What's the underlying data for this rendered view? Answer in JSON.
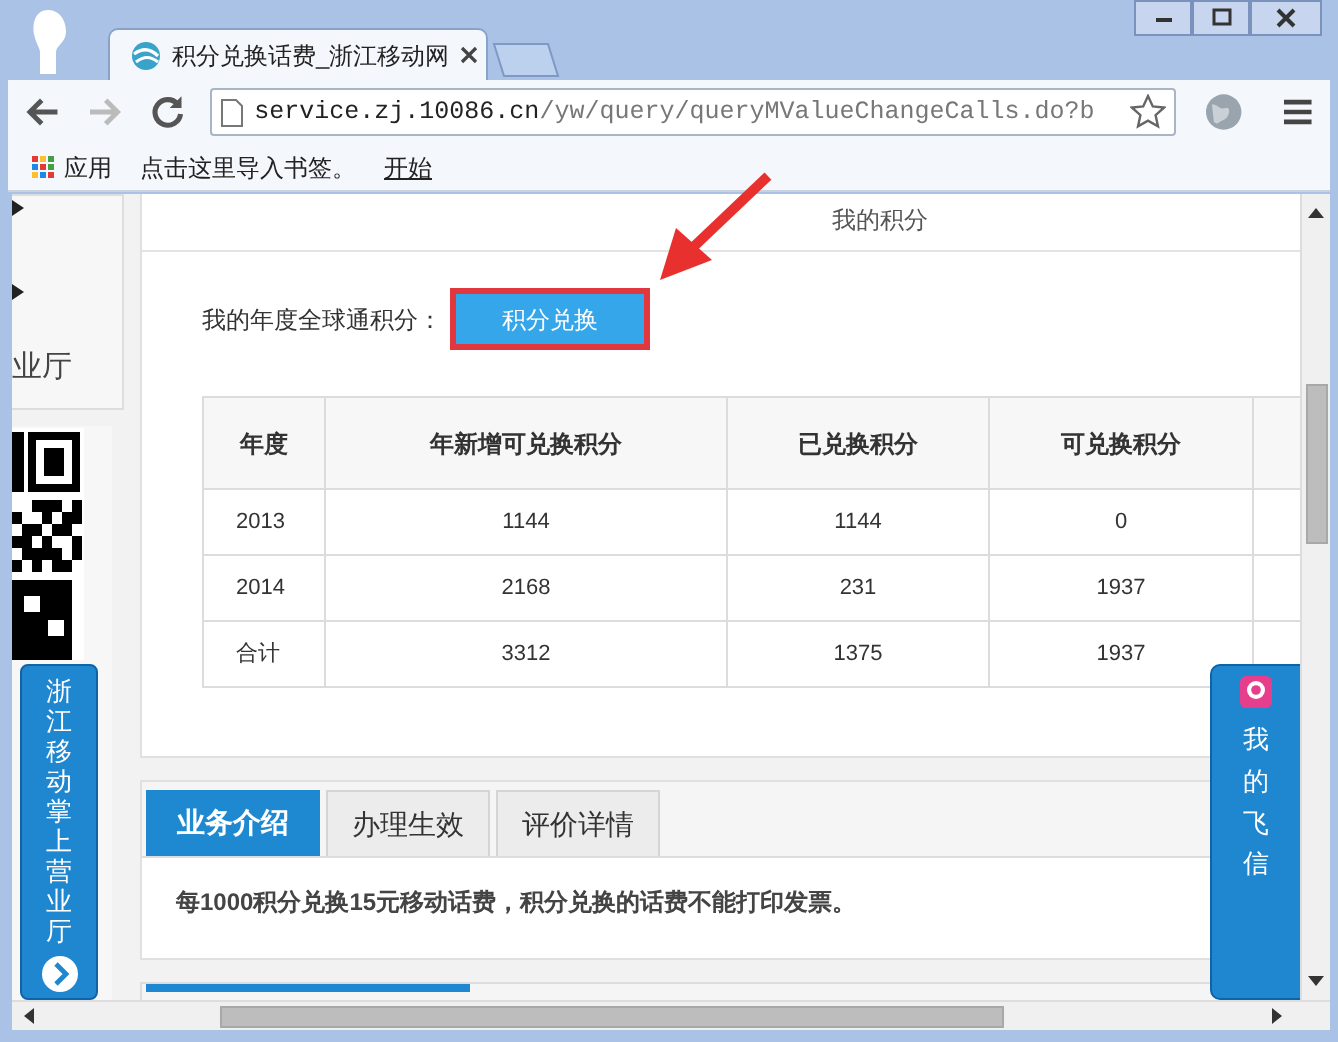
{
  "browser": {
    "tabs": [
      {
        "title": "积分兑换话费_浙江移动网",
        "selected": true
      }
    ],
    "url": {
      "host": "service.zj.10086.cn",
      "path": "/yw/query/queryMValueChangeCalls.do?b"
    },
    "bookmarks": [
      {
        "label": "应用",
        "kind": "apps"
      },
      {
        "label": "点击这里导入书签。",
        "kind": "text"
      },
      {
        "label": "开始",
        "kind": "link"
      }
    ]
  },
  "sidebar": {
    "heading": "业厅",
    "banner": "浙江移动掌上营业厅"
  },
  "points": {
    "title": "我的积分",
    "label": "我的年度全球通积分：",
    "button": "积分兑换",
    "table": {
      "columns": [
        "年度",
        "年新增可兑换积分",
        "已兑换积分",
        "可兑换积分"
      ],
      "rows": [
        [
          "2013",
          "1144",
          "1144",
          "0"
        ],
        [
          "2014",
          "2168",
          "231",
          "1937"
        ],
        [
          "合计",
          "3312",
          "1375",
          "1937"
        ]
      ]
    }
  },
  "service_tabs": [
    {
      "label": "业务介绍",
      "selected": true
    },
    {
      "label": "办理生效",
      "selected": false
    },
    {
      "label": "评价详情",
      "selected": false
    }
  ],
  "description": "每1000积分兑换15元移动话费，积分兑换的话费不能打印发票。",
  "float_panel": {
    "label": "我的飞信"
  }
}
